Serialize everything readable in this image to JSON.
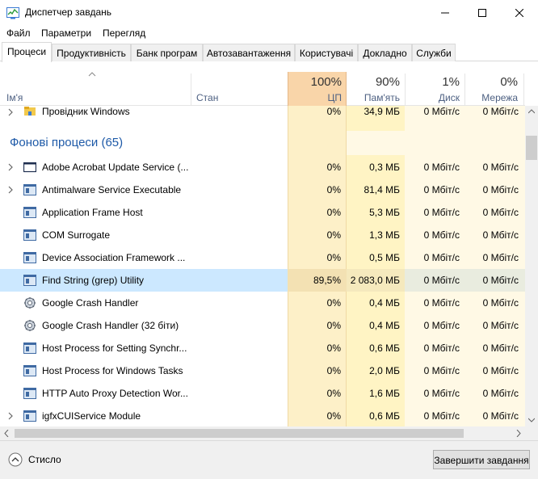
{
  "window": {
    "title": "Диспетчер завдань"
  },
  "menu": {
    "items": [
      "Файл",
      "Параметри",
      "Перегляд"
    ]
  },
  "tabs": [
    "Процеси",
    "Продуктивність",
    "Банк програм",
    "Автозавантаження",
    "Користувачі",
    "Докладно",
    "Служби"
  ],
  "columns": {
    "name": "Ім'я",
    "status": "Стан",
    "cpu": {
      "pct": "100%",
      "label": "ЦП"
    },
    "memory": {
      "pct": "90%",
      "label": "Пам'ять"
    },
    "disk": {
      "pct": "1%",
      "label": "Диск"
    },
    "network": {
      "pct": "0%",
      "label": "Мережа"
    }
  },
  "top_row": {
    "name": "Провідник Windows",
    "cpu": "0%",
    "memory": "34,9 МБ",
    "disk": "0 Мбіт/с",
    "network": "0 Мбіт/с"
  },
  "group": {
    "title": "Фонові процеси (65)"
  },
  "processes": [
    {
      "name": "Adobe Acrobat Update Service (...",
      "cpu": "0%",
      "memory": "0,3 МБ",
      "disk": "0 Мбіт/с",
      "network": "0 Мбіт/с",
      "expand": true,
      "icon": "window-icon"
    },
    {
      "name": "Antimalware Service Executable",
      "cpu": "0%",
      "memory": "81,4 МБ",
      "disk": "0 Мбіт/с",
      "network": "0 Мбіт/с",
      "expand": true,
      "icon": "service-icon"
    },
    {
      "name": "Application Frame Host",
      "cpu": "0%",
      "memory": "5,3 МБ",
      "disk": "0 Мбіт/с",
      "network": "0 Мбіт/с",
      "expand": false,
      "icon": "service-icon"
    },
    {
      "name": "COM Surrogate",
      "cpu": "0%",
      "memory": "1,3 МБ",
      "disk": "0 Мбіт/с",
      "network": "0 Мбіт/с",
      "expand": false,
      "icon": "service-icon"
    },
    {
      "name": "Device Association Framework ...",
      "cpu": "0%",
      "memory": "0,5 МБ",
      "disk": "0 Мбіт/с",
      "network": "0 Мбіт/с",
      "expand": false,
      "icon": "service-icon"
    },
    {
      "name": "Find String (grep) Utility",
      "cpu": "89,5%",
      "memory": "2 083,0 МБ",
      "disk": "0 Мбіт/с",
      "network": "0 Мбіт/с",
      "expand": false,
      "icon": "service-icon",
      "selected": true
    },
    {
      "name": "Google Crash Handler",
      "cpu": "0%",
      "memory": "0,4 МБ",
      "disk": "0 Мбіт/с",
      "network": "0 Мбіт/с",
      "expand": false,
      "icon": "gear-icon"
    },
    {
      "name": "Google Crash Handler (32 біти)",
      "cpu": "0%",
      "memory": "0,4 МБ",
      "disk": "0 Мбіт/с",
      "network": "0 Мбіт/с",
      "expand": false,
      "icon": "gear-icon"
    },
    {
      "name": "Host Process for Setting Synchr...",
      "cpu": "0%",
      "memory": "0,6 МБ",
      "disk": "0 Мбіт/с",
      "network": "0 Мбіт/с",
      "expand": false,
      "icon": "service-icon"
    },
    {
      "name": "Host Process for Windows Tasks",
      "cpu": "0%",
      "memory": "2,0 МБ",
      "disk": "0 Мбіт/с",
      "network": "0 Мбіт/с",
      "expand": false,
      "icon": "service-icon"
    },
    {
      "name": "HTTP Auto Proxy Detection Wor...",
      "cpu": "0%",
      "memory": "1,6 МБ",
      "disk": "0 Мбіт/с",
      "network": "0 Мбіт/с",
      "expand": false,
      "icon": "service-icon"
    },
    {
      "name": "igfxCUIService Module",
      "cpu": "0%",
      "memory": "0,6 МБ",
      "disk": "0 Мбіт/с",
      "network": "0 Мбіт/с",
      "expand": true,
      "icon": "service-icon"
    }
  ],
  "footer": {
    "fewer_details": "Стисло",
    "end_task": "Завершити завдання"
  },
  "colors": {
    "cpu_heat": "#f9d5a9",
    "cpu_col": "#fdf0c8",
    "mem_col": "#fff4c4",
    "selection": "#cce8ff",
    "group_title": "#1e5aa8"
  }
}
